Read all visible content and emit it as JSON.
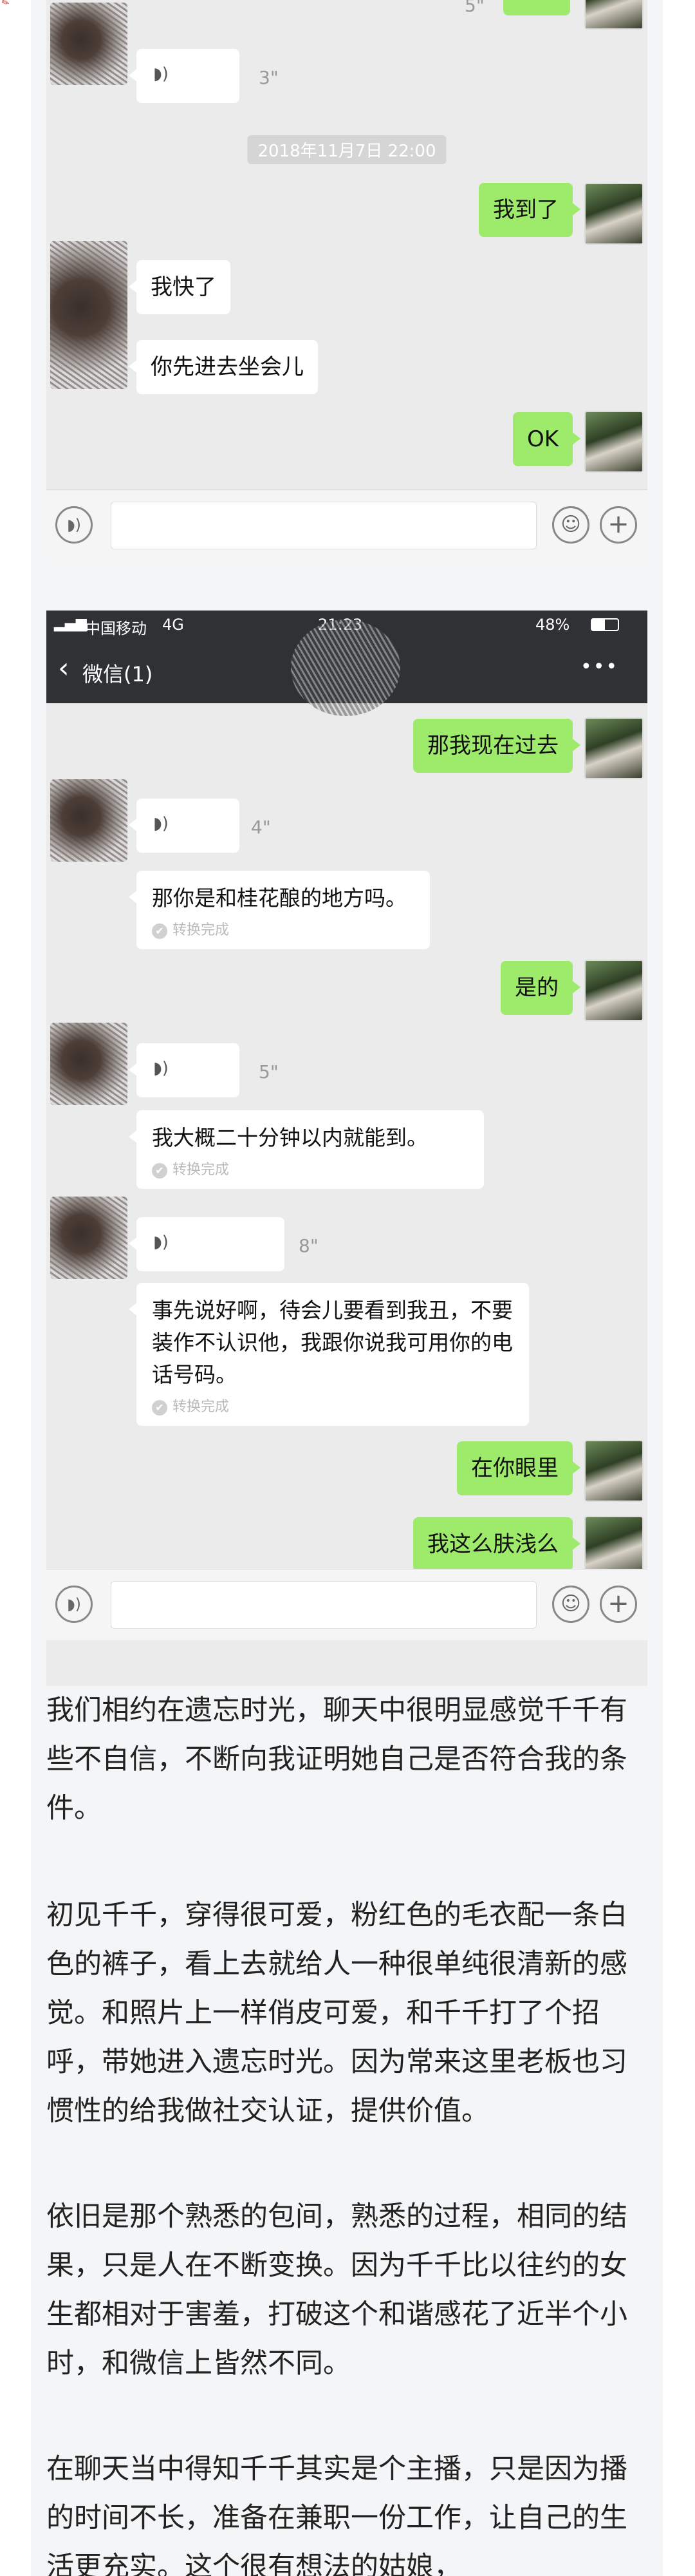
{
  "shot1": {
    "top_duration": "5\"",
    "voice1_duration": "3\"",
    "timestamp": "2018年11月7日 22:00",
    "msg_arrived": "我到了",
    "msg_almost": "我快了",
    "msg_go_sit": "你先进去坐会儿",
    "msg_ok": "OK"
  },
  "shot2": {
    "status": {
      "carrier": "中国移动",
      "network": "4G",
      "time": "21:23",
      "battery": "48%"
    },
    "nav": {
      "back_label": "微信(1)",
      "more_label": "•••"
    },
    "msg_go_now": "那我现在过去",
    "voice1_duration": "4\"",
    "card1_text": "那你是和桂花酿的地方吗。",
    "convert_done": "转换完成",
    "msg_yes": "是的",
    "voice2_duration": "5\"",
    "card2_text": "我大概二十分钟以内就能到。",
    "voice3_duration": "8\"",
    "card3_text": "事先说好啊，待会儿要看到我丑，不要装作不认识他，我跟你说我可用你的电话号码。",
    "msg_in_eye": "在你眼里",
    "msg_shallow": "我这么肤浅么"
  },
  "article": {
    "p1": "我们相约在遗忘时光，聊天中很明显感觉千千有些不自信，不断向我证明她自己是否符合我的条件。",
    "p2": "初见千千，穿得很可爱，粉红色的毛衣配一条白色的裤子，看上去就给人一种很单纯很清新的感觉。和照片上一样俏皮可爱，和千千打了个招呼，带她进入遗忘时光。因为常来这里老板也习惯性的给我做社交认证，提供价值。",
    "p3": "依旧是那个熟悉的包间，熟悉的过程，相同的结果，只是人在不断变换。因为千千比以往约的女生都相对于害羞，打破这个和谐感花了近半个小时，和微信上皆然不同。",
    "p4": "在聊天当中得知千千其实是个主播，只是因为播的时间不长，准备在兼职一份工作，让自己的生活更充实。这个很有想法的姑娘，"
  },
  "icons": {
    "voice_wave": "voice-wave-icon",
    "emoji": "emoji-icon",
    "plus": "plus-icon",
    "signal": "signal-icon",
    "battery": "battery-icon",
    "back": "back-chevron-icon"
  }
}
